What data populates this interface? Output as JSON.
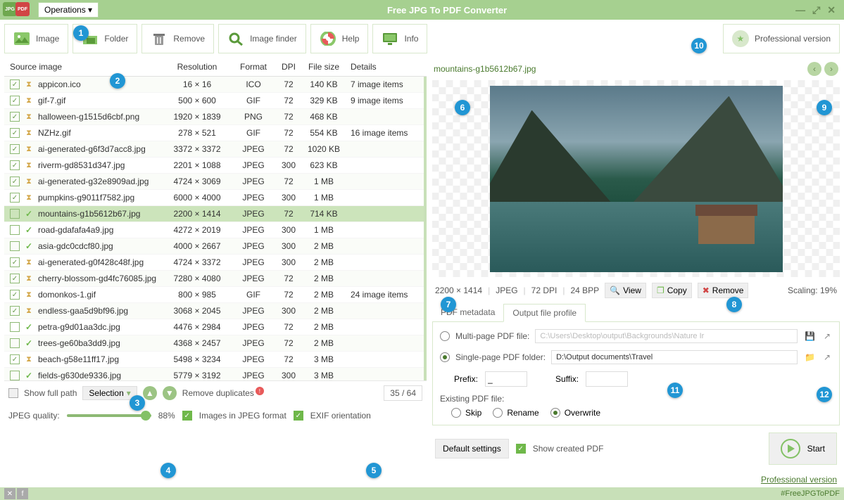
{
  "app": {
    "title": "Free JPG To PDF Converter",
    "operations": "Operations ▾"
  },
  "toolbar": {
    "image": "Image",
    "folder": "Folder",
    "remove": "Remove",
    "finder": "Image finder",
    "help": "Help",
    "info": "Info",
    "pro": "Professional version"
  },
  "table": {
    "headers": {
      "src": "Source image",
      "res": "Resolution",
      "fmt": "Format",
      "dpi": "DPI",
      "size": "File size",
      "det": "Details"
    },
    "rows": [
      {
        "chk": true,
        "state": "hourglass",
        "name": "appicon.ico",
        "res": "16 × 16",
        "fmt": "ICO",
        "dpi": "72",
        "size": "140 KB",
        "det": "7 image items",
        "sel": false
      },
      {
        "chk": true,
        "state": "hourglass",
        "name": "gif-7.gif",
        "res": "500 × 600",
        "fmt": "GIF",
        "dpi": "72",
        "size": "329 KB",
        "det": "9 image items",
        "sel": false
      },
      {
        "chk": true,
        "state": "hourglass",
        "name": "halloween-g1515d6cbf.png",
        "res": "1920 × 1839",
        "fmt": "PNG",
        "dpi": "72",
        "size": "468 KB",
        "det": "",
        "sel": false
      },
      {
        "chk": true,
        "state": "hourglass",
        "name": "NZHz.gif",
        "res": "278 × 521",
        "fmt": "GIF",
        "dpi": "72",
        "size": "554 KB",
        "det": "16 image items",
        "sel": false
      },
      {
        "chk": true,
        "state": "hourglass",
        "name": "ai-generated-g6f3d7acc8.jpg",
        "res": "3372 × 3372",
        "fmt": "JPEG",
        "dpi": "72",
        "size": "1020 KB",
        "det": "",
        "sel": false
      },
      {
        "chk": true,
        "state": "hourglass",
        "name": "riverm-gd8531d347.jpg",
        "res": "2201 × 1088",
        "fmt": "JPEG",
        "dpi": "300",
        "size": "623 KB",
        "det": "",
        "sel": false
      },
      {
        "chk": true,
        "state": "hourglass",
        "name": "ai-generated-g32e8909ad.jpg",
        "res": "4724 × 3069",
        "fmt": "JPEG",
        "dpi": "72",
        "size": "1 MB",
        "det": "",
        "sel": false
      },
      {
        "chk": true,
        "state": "hourglass",
        "name": "pumpkins-g9011f7582.jpg",
        "res": "6000 × 4000",
        "fmt": "JPEG",
        "dpi": "300",
        "size": "1 MB",
        "det": "",
        "sel": false
      },
      {
        "chk": false,
        "state": "done",
        "name": "mountains-g1b5612b67.jpg",
        "res": "2200 × 1414",
        "fmt": "JPEG",
        "dpi": "72",
        "size": "714 KB",
        "det": "",
        "sel": true
      },
      {
        "chk": false,
        "state": "done",
        "name": "road-gdafafa4a9.jpg",
        "res": "4272 × 2019",
        "fmt": "JPEG",
        "dpi": "300",
        "size": "1 MB",
        "det": "",
        "sel": false
      },
      {
        "chk": false,
        "state": "done",
        "name": "asia-gdc0cdcf80.jpg",
        "res": "4000 × 2667",
        "fmt": "JPEG",
        "dpi": "300",
        "size": "2 MB",
        "det": "",
        "sel": false
      },
      {
        "chk": true,
        "state": "hourglass",
        "name": "ai-generated-g0f428c48f.jpg",
        "res": "4724 × 3372",
        "fmt": "JPEG",
        "dpi": "300",
        "size": "2 MB",
        "det": "",
        "sel": false
      },
      {
        "chk": true,
        "state": "hourglass",
        "name": "cherry-blossom-gd4fc76085.jpg",
        "res": "7280 × 4080",
        "fmt": "JPEG",
        "dpi": "72",
        "size": "2 MB",
        "det": "",
        "sel": false
      },
      {
        "chk": true,
        "state": "hourglass",
        "name": "domonkos-1.gif",
        "res": "800 × 985",
        "fmt": "GIF",
        "dpi": "72",
        "size": "2 MB",
        "det": "24 image items",
        "sel": false
      },
      {
        "chk": true,
        "state": "hourglass",
        "name": "endless-gaa5d9bf96.jpg",
        "res": "3068 × 2045",
        "fmt": "JPEG",
        "dpi": "300",
        "size": "2 MB",
        "det": "",
        "sel": false
      },
      {
        "chk": false,
        "state": "done",
        "name": "petra-g9d01aa3dc.jpg",
        "res": "4476 × 2984",
        "fmt": "JPEG",
        "dpi": "72",
        "size": "2 MB",
        "det": "",
        "sel": false
      },
      {
        "chk": false,
        "state": "done",
        "name": "trees-ge60ba3dd9.jpg",
        "res": "4368 × 2457",
        "fmt": "JPEG",
        "dpi": "72",
        "size": "2 MB",
        "det": "",
        "sel": false
      },
      {
        "chk": true,
        "state": "hourglass",
        "name": "beach-g58e11ff17.jpg",
        "res": "5498 × 3234",
        "fmt": "JPEG",
        "dpi": "72",
        "size": "3 MB",
        "det": "",
        "sel": false
      },
      {
        "chk": false,
        "state": "done",
        "name": "fields-g630de9336.jpg",
        "res": "5779 × 3192",
        "fmt": "JPEG",
        "dpi": "300",
        "size": "3 MB",
        "det": "",
        "sel": false
      }
    ]
  },
  "footer": {
    "show_full_path": "Show full path",
    "selection": "Selection",
    "remove_dup": "Remove duplicates",
    "counter": "35 / 64",
    "quality_label": "JPEG quality:",
    "quality_value": "88%",
    "jpeg_fmt": "Images in JPEG format",
    "exif": "EXIF orientation",
    "hashtag": "#FreeJPGToPDF"
  },
  "preview": {
    "title": "mountains-g1b5612b67.jpg",
    "res": "2200 × 1414",
    "fmt": "JPEG",
    "dpi": "72 DPI",
    "bpp": "24 BPP",
    "view": "View",
    "copy": "Copy",
    "remove": "Remove",
    "scaling": "Scaling: 19%"
  },
  "tabs": {
    "meta": "PDF metadata",
    "profile": "Output file profile"
  },
  "output": {
    "multi_label": "Multi-page PDF file:",
    "multi_path": "C:\\Users\\Desktop\\output\\Backgrounds\\Nature Ir",
    "single_label": "Single-page PDF folder:",
    "single_path": "D:\\Output documents\\Travel",
    "prefix": "Prefix:",
    "prefix_val": "_",
    "suffix": "Suffix:",
    "existing": "Existing PDF file:",
    "skip": "Skip",
    "rename": "Rename",
    "overwrite": "Overwrite"
  },
  "actions": {
    "defaults": "Default settings",
    "show_created": "Show created PDF",
    "start": "Start",
    "pro_link": "Professional version"
  },
  "annotations": [
    "1",
    "2",
    "3",
    "4",
    "5",
    "6",
    "7",
    "8",
    "9",
    "10",
    "11",
    "12"
  ]
}
